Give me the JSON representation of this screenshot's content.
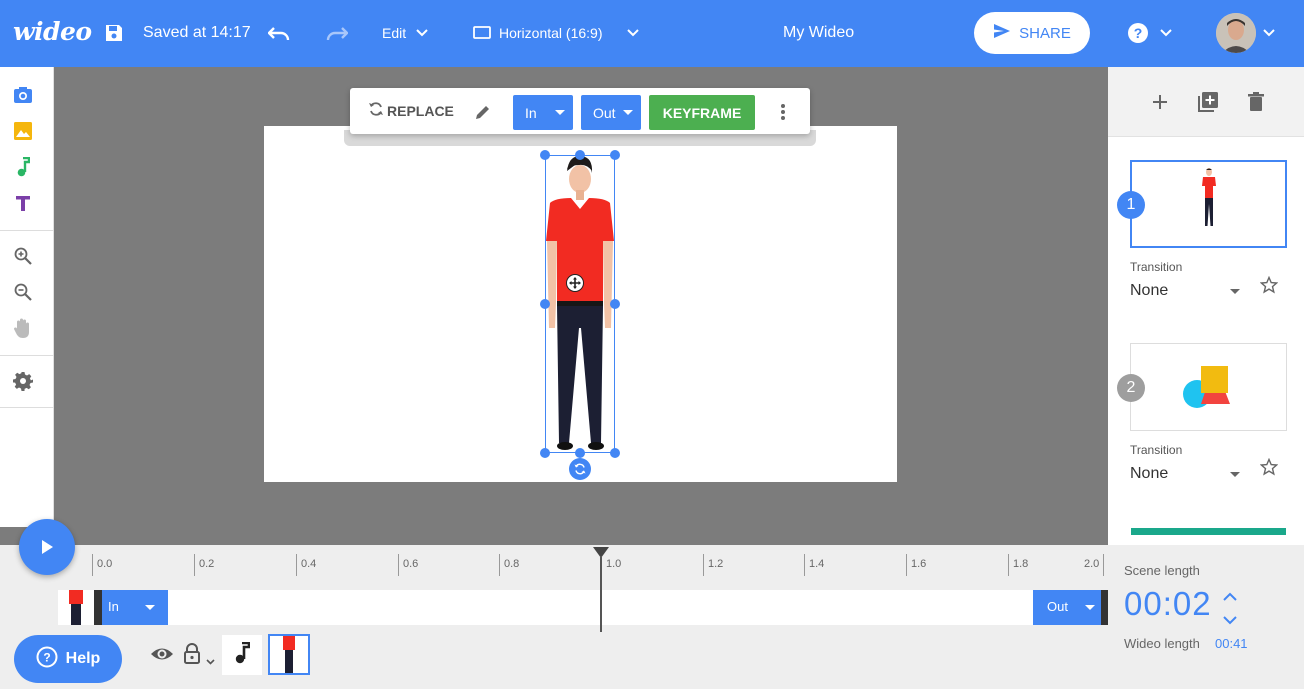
{
  "header": {
    "logo": "wideo",
    "saved_status": "Saved at 14:17",
    "edit_menu": "Edit",
    "aspect_ratio": "Horizontal (16:9)",
    "project_title": "My Wideo",
    "share_label": "SHARE"
  },
  "left_toolbar": {
    "items": [
      "camera-icon",
      "image-icon",
      "music-note-icon",
      "text-icon",
      "zoom-in-icon",
      "zoom-out-icon",
      "hand-icon",
      "gear-icon"
    ]
  },
  "context_toolbar": {
    "replace_label": "REPLACE",
    "in_label": "In",
    "out_label": "Out",
    "keyframe_label": "KEYFRAME"
  },
  "scenes": [
    {
      "number": "1",
      "transition_label": "Transition",
      "transition_value": "None"
    },
    {
      "number": "2",
      "transition_label": "Transition",
      "transition_value": "None"
    }
  ],
  "timeline": {
    "ticks": [
      "0.0",
      "0.2",
      "0.4",
      "0.6",
      "0.8",
      "1.0",
      "1.2",
      "1.4",
      "1.6",
      "1.8",
      "2.0"
    ],
    "in_label": "In",
    "out_label": "Out",
    "scene_length_label": "Scene length",
    "scene_length_value": "00:02",
    "wideo_length_label": "Wideo length",
    "wideo_length_value": "00:41"
  },
  "help_label": "Help",
  "colors": {
    "brand": "#4286f4",
    "keyframe": "#4caf50",
    "shirt": "#f22b22"
  }
}
